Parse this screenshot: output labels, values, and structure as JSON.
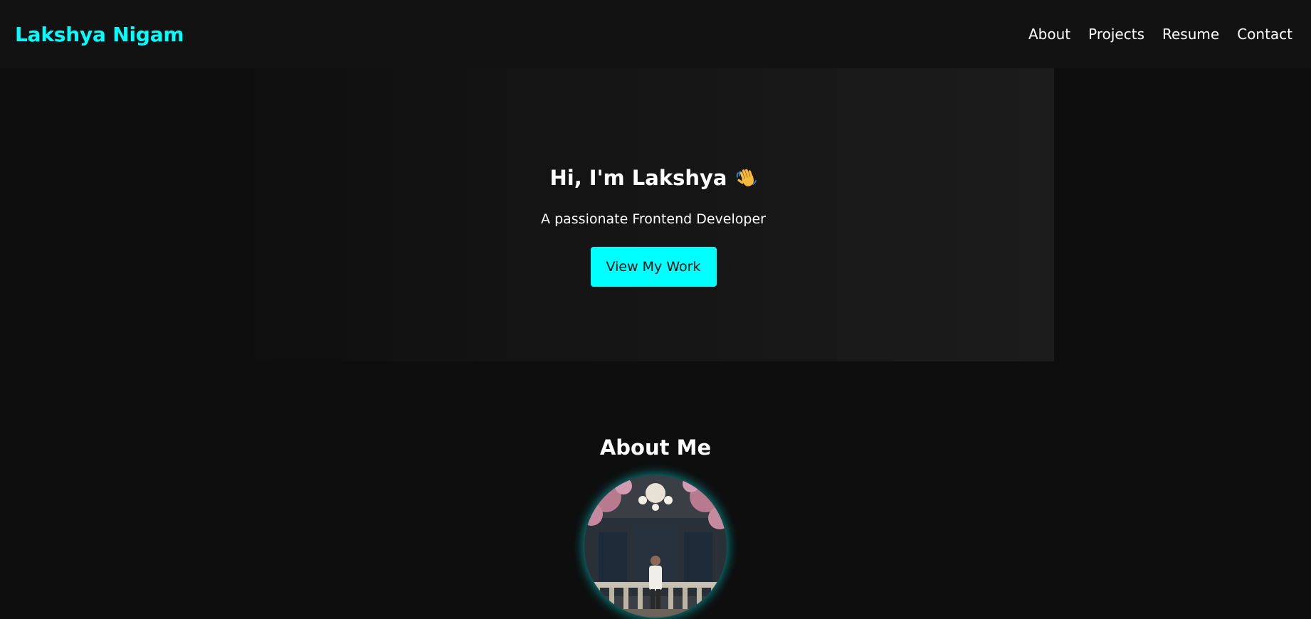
{
  "navbar": {
    "brand": "Lakshya Nigam",
    "links": [
      "About",
      "Projects",
      "Resume",
      "Contact"
    ]
  },
  "hero": {
    "title": "Hi, I'm Lakshya",
    "subtitle": "A passionate Frontend Developer",
    "cta_label": "View My Work"
  },
  "about": {
    "title": "About Me",
    "avatar_icon": "profile-photo"
  },
  "colors": {
    "accent": "#00ffff",
    "background": "#0e0e0e",
    "navbar": "#121212"
  }
}
